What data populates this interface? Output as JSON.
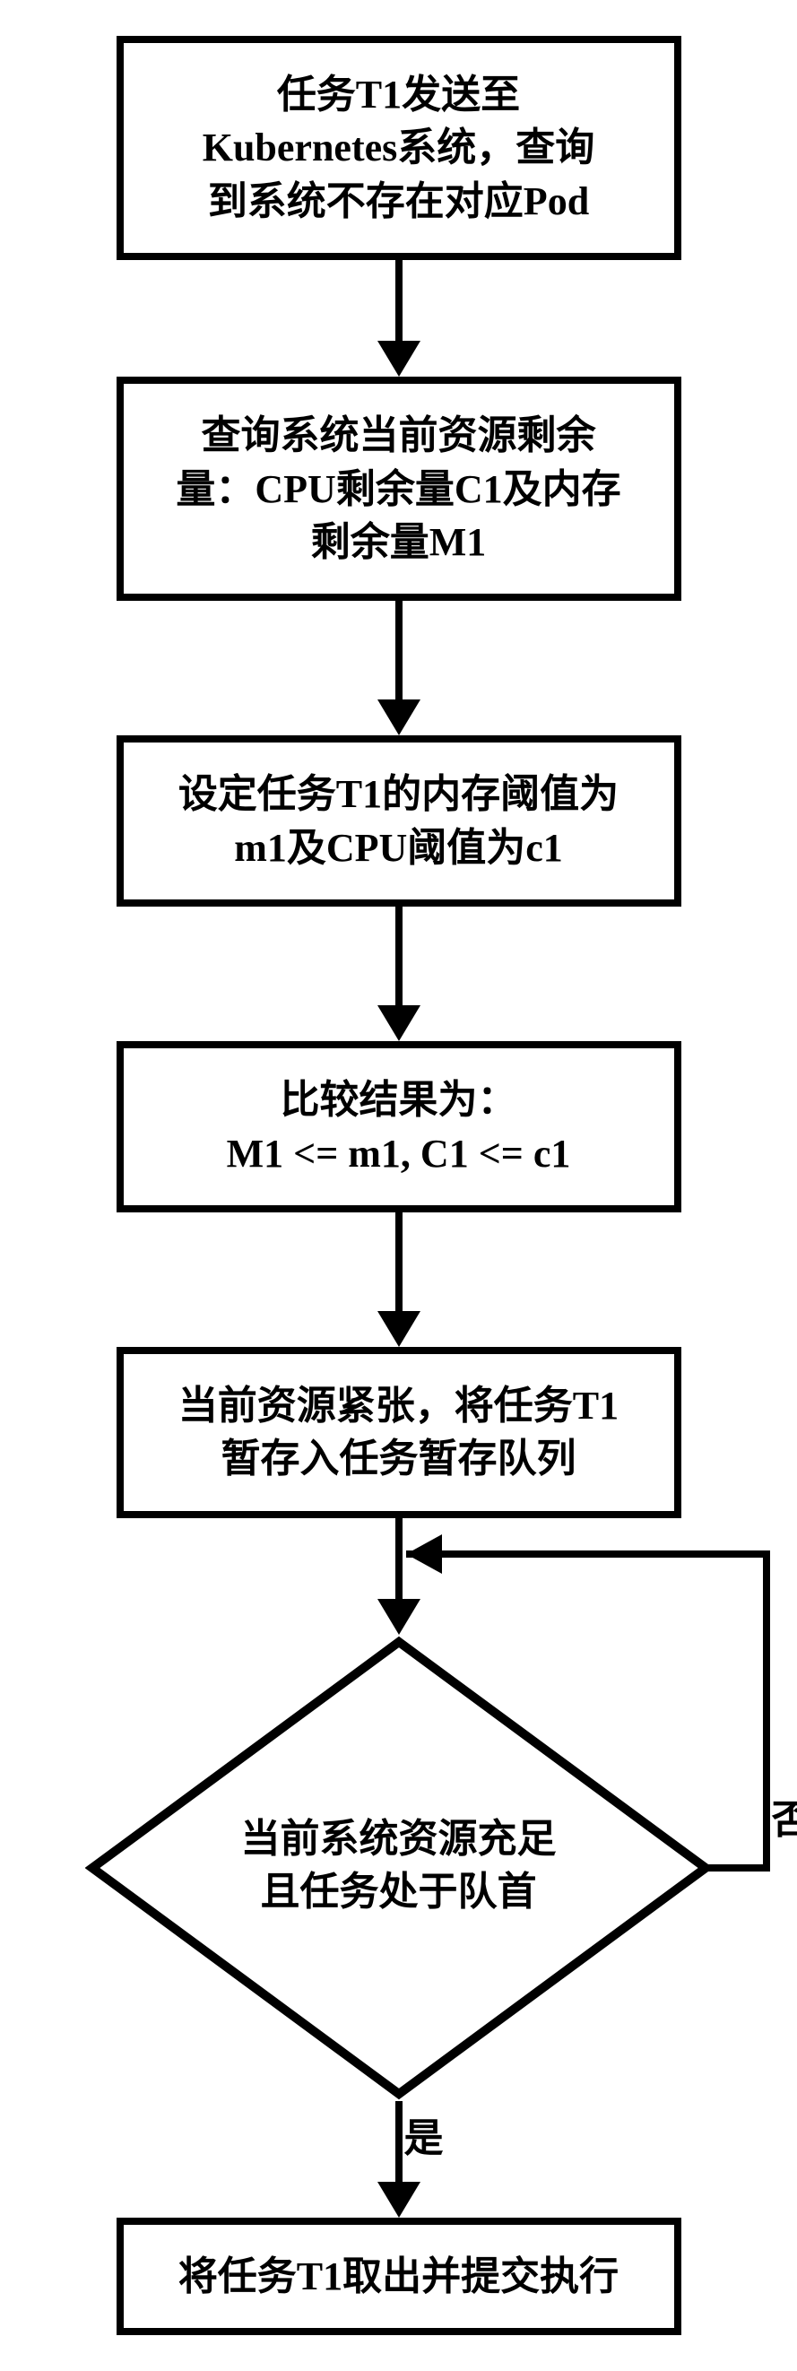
{
  "nodes": {
    "n1": "任务T1发送至\nKubernetes系统，查询\n到系统不存在对应Pod",
    "n2": "查询系统当前资源剩余\n量：CPU剩余量C1及内存\n剩余量M1",
    "n3": "设定任务T1的内存阈值为\nm1及CPU阈值为c1",
    "n4": "比较结果为：\nM1 <= m1, C1 <= c1",
    "n5": "当前资源紧张，将任务T1\n暂存入任务暂存队列",
    "decision": "当前系统资源充足\n且任务处于队首",
    "n6": "将任务T1取出并提交执行"
  },
  "labels": {
    "no": "否",
    "yes": "是"
  }
}
